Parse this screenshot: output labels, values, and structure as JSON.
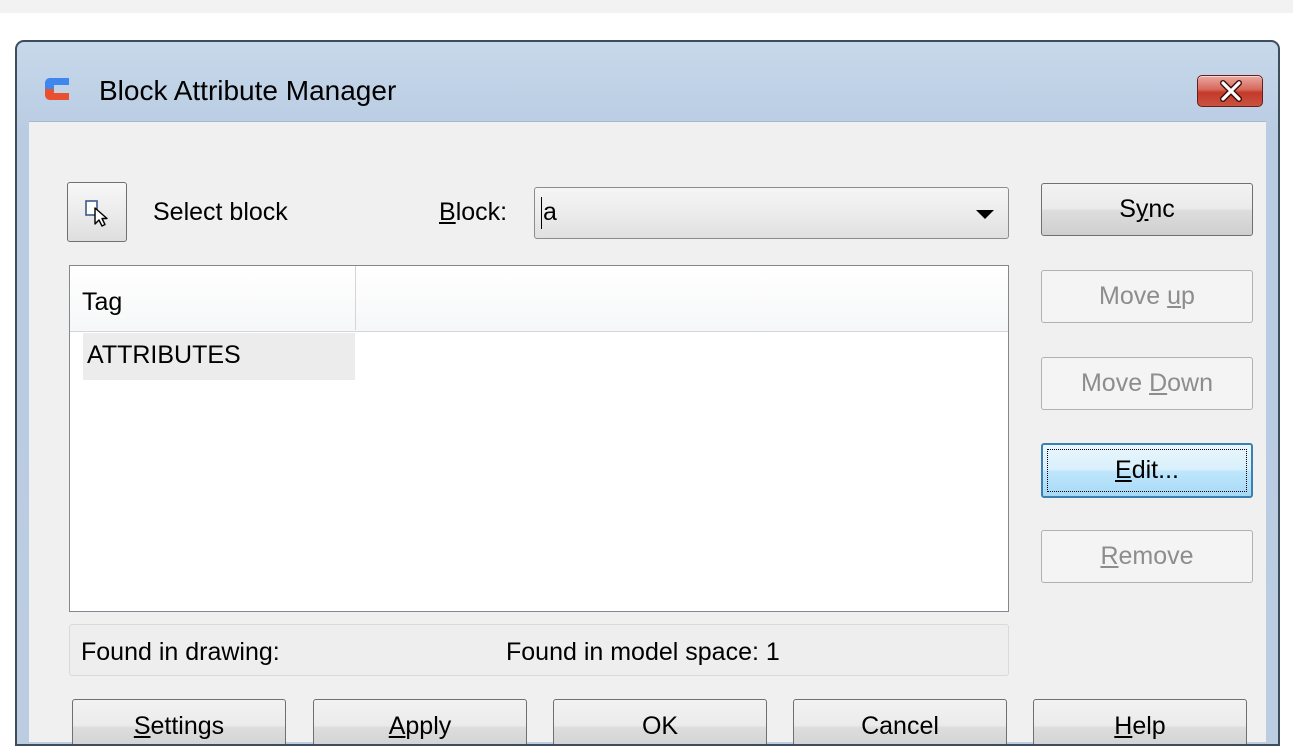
{
  "dialog": {
    "title": "Block Attribute Manager",
    "icons": {
      "app": "app-logo-icon",
      "close": "close-icon"
    }
  },
  "select_block": {
    "icon": "select-objects-icon",
    "label": "Select block"
  },
  "block": {
    "label_mnemonic": "B",
    "label_rest": "lock:",
    "value": "a"
  },
  "list": {
    "columns": [
      "Tag",
      ""
    ],
    "rows": [
      {
        "tag": "ATTRIBUTES"
      }
    ]
  },
  "status": {
    "found_in_drawing": "Found in drawing:",
    "found_in_model_space": "Found in model space:  1"
  },
  "side_buttons": {
    "sync": {
      "pre": "S",
      "mn": "y",
      "post": "nc"
    },
    "move_up": {
      "pre": "Move ",
      "mn": "u",
      "post": "p"
    },
    "move_down": {
      "pre": "Move ",
      "mn": "D",
      "post": "own"
    },
    "edit": {
      "pre": "",
      "mn": "E",
      "post": "dit..."
    },
    "remove": {
      "pre": "",
      "mn": "R",
      "post": "emove"
    }
  },
  "bottom_buttons": {
    "settings": {
      "pre": "",
      "mn": "S",
      "post": "ettings"
    },
    "apply": {
      "pre": "",
      "mn": "A",
      "post": "pply"
    },
    "ok": "OK",
    "cancel": "Cancel",
    "help": {
      "pre": "",
      "mn": "H",
      "post": "elp"
    }
  },
  "colors": {
    "title_bar": "#b9cce2",
    "close_button": "#c4392a",
    "app_logo": "#2b6fd6"
  }
}
